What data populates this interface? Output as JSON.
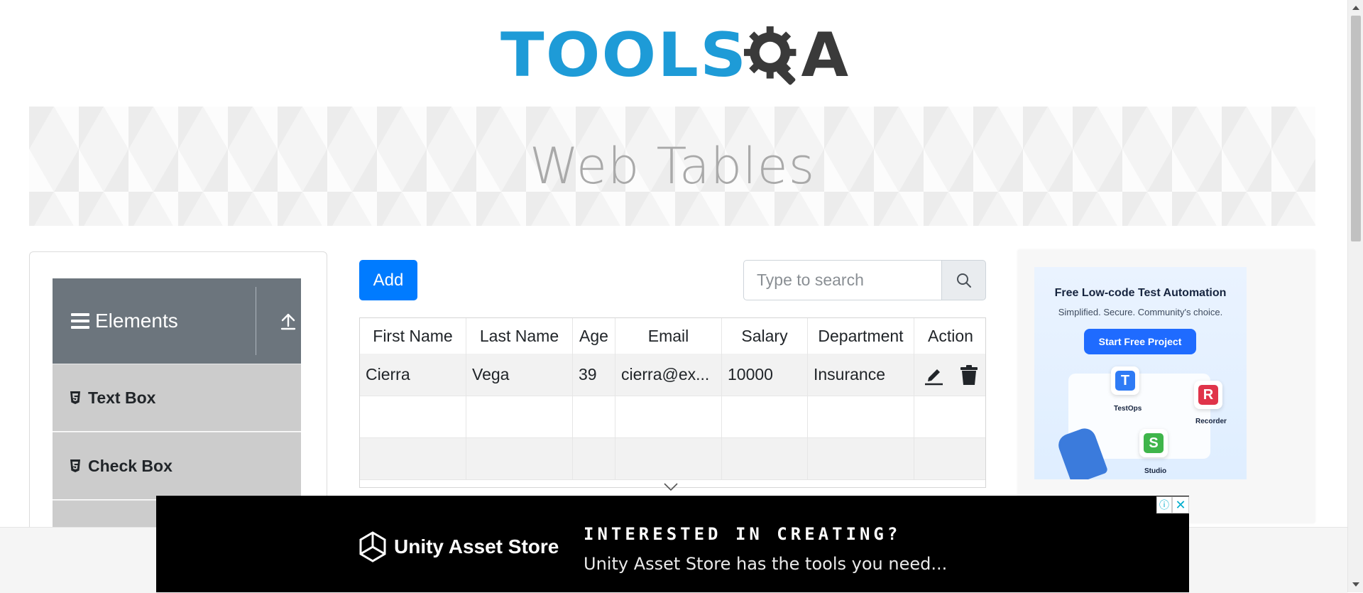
{
  "header": {
    "logo_text_left": "TOOLS",
    "logo_text_right": "A"
  },
  "banner": {
    "title": "Web Tables"
  },
  "sidebar": {
    "group_title": "Elements",
    "items": [
      {
        "label": "Text Box"
      },
      {
        "label": "Check Box"
      }
    ]
  },
  "toolbar": {
    "add_label": "Add",
    "search_placeholder": "Type to search"
  },
  "table": {
    "columns": [
      "First Name",
      "Last Name",
      "Age",
      "Email",
      "Salary",
      "Department",
      "Action"
    ],
    "rows": [
      {
        "first_name": "Cierra",
        "last_name": "Vega",
        "age": "39",
        "email": "cierra@ex...",
        "salary": "10000",
        "department": "Insurance"
      }
    ]
  },
  "right_ad": {
    "title": "Free Low-code Test Automation",
    "subtitle": "Simplified. Secure. Community's choice.",
    "cta": "Start Free Project",
    "tiles": [
      "TestOps",
      "Recorder",
      "Studio"
    ]
  },
  "bottom_ad": {
    "brand": "Unity Asset Store",
    "headline": "INTERESTED IN CREATING?",
    "subline": "Unity Asset Store has the tools you need...",
    "info_glyph": "ⓘ",
    "close_glyph": "✕"
  },
  "colors": {
    "primary": "#007bff",
    "logo_blue": "#1e9bd7",
    "sidebar_header": "#6c757d",
    "menu_item": "#cccccc"
  }
}
